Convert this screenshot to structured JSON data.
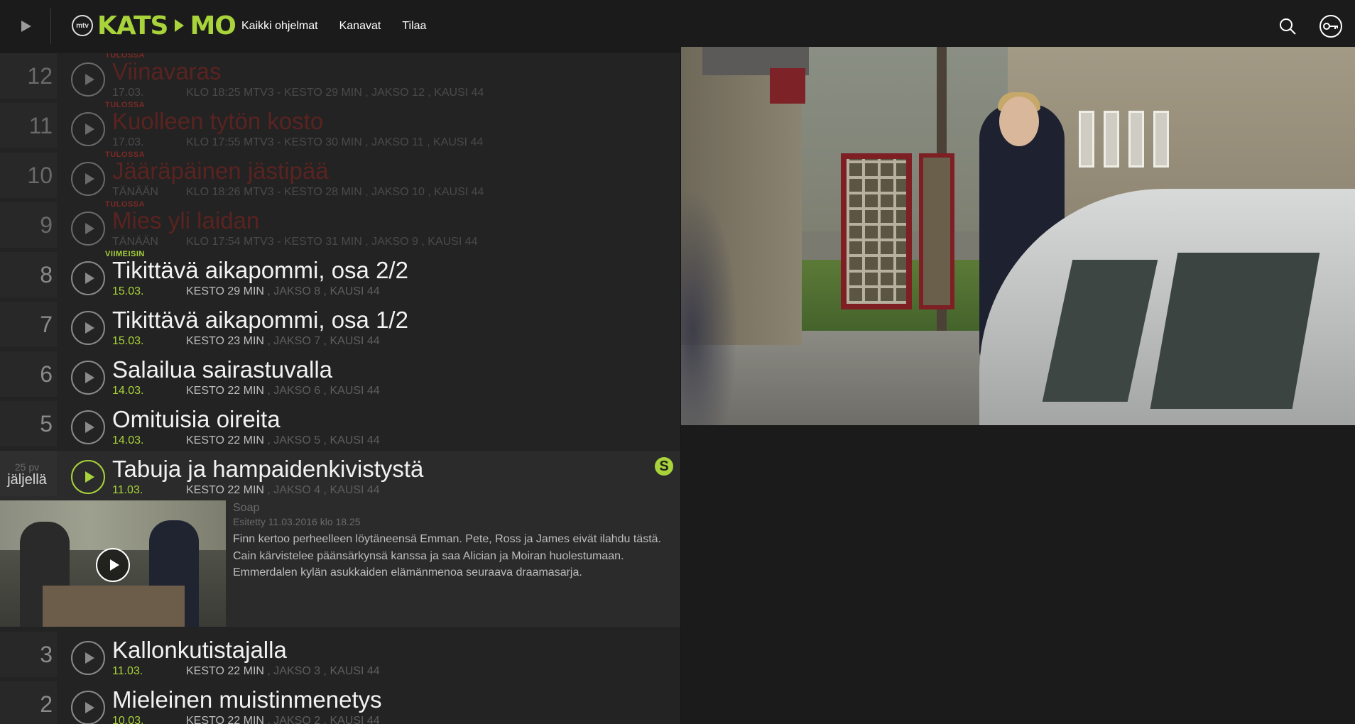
{
  "header": {
    "logo_mtv": "mtv",
    "logo_left": "KATS",
    "logo_right": "MO",
    "nav": [
      "Kaikki ohjelmat",
      "Kanavat",
      "Tilaa"
    ],
    "icons": [
      "play-icon",
      "search-icon",
      "key-icon"
    ]
  },
  "episodes": [
    {
      "num": "12",
      "tag": "TULOSSA",
      "title": "Viinavaras",
      "date": "17.03.",
      "info": "KLO 18:25 MTV3 - KESTO 29 MIN , JAKSO 12 , KAUSI 44",
      "state": "upcoming"
    },
    {
      "num": "11",
      "tag": "TULOSSA",
      "title": "Kuolleen tytön kosto",
      "date": "17.03.",
      "info": "KLO 17:55 MTV3 - KESTO 30 MIN , JAKSO 11 , KAUSI 44",
      "state": "upcoming"
    },
    {
      "num": "10",
      "tag": "TULOSSA",
      "title": "Jääräpäinen jästipää",
      "date": "TÄNÄÄN",
      "info": "KLO 18:26 MTV3 - KESTO 28 MIN , JAKSO 10 , KAUSI 44",
      "state": "upcoming"
    },
    {
      "num": "9",
      "tag": "TULOSSA",
      "title": "Mies yli laidan",
      "date": "TÄNÄÄN",
      "info": "KLO 17:54 MTV3 - KESTO 31 MIN , JAKSO 9 , KAUSI 44",
      "state": "upcoming"
    },
    {
      "num": "8",
      "tag": "VIIMEISIN",
      "title": "Tikittävä aikapommi, osa 2/2",
      "date": "15.03.",
      "duration": "KESTO 29 MIN",
      "rest": " , JAKSO 8 , KAUSI 44",
      "state": "normal"
    },
    {
      "num": "7",
      "tag": "",
      "title": "Tikittävä aikapommi, osa 1/2",
      "date": "15.03.",
      "duration": "KESTO 23 MIN",
      "rest": " , JAKSO 7 , KAUSI 44",
      "state": "normal"
    },
    {
      "num": "6",
      "tag": "",
      "title": "Salailua sairastuvalla",
      "date": "14.03.",
      "duration": "KESTO 22 MIN",
      "rest": " , JAKSO 6 , KAUSI 44",
      "state": "normal"
    },
    {
      "num": "5",
      "tag": "",
      "title": "Omituisia oireita",
      "date": "14.03.",
      "duration": "KESTO 22 MIN",
      "rest": " , JAKSO 5 , KAUSI 44",
      "state": "normal"
    },
    {
      "num": "3",
      "tag": "",
      "title": "Kallonkutistajalla",
      "date": "11.03.",
      "duration": "KESTO 22 MIN",
      "rest": " , JAKSO 3 , KAUSI 44",
      "state": "normal"
    },
    {
      "num": "2",
      "tag": "",
      "title": "Mieleinen muistinmenetys",
      "date": "10.03.",
      "duration": "KESTO 22 MIN",
      "rest": " , JAKSO 2 , KAUSI 44",
      "state": "normal"
    }
  ],
  "selected": {
    "days": "25 pv",
    "remaining": "jäljellä",
    "title": "Tabuja ja hampaidenkivistystä",
    "date": "11.03.",
    "duration": "KESTO 22 MIN",
    "rest": " , JAKSO 4 , KAUSI 44",
    "badge": "S",
    "genre": "Soap",
    "aired": "Esitetty 11.03.2016 klo 18.25",
    "description": "Finn kertoo perheelleen löytäneensä Emman. Pete, Ross ja James eivät ilahdu tästä. Cain kärvistelee päänsärkynsä kanssa ja saa Alician ja Moiran huolestumaan. Emmerdalen kylän asukkaiden elämänmenoa seuraava draamasarja."
  },
  "colors": {
    "accent": "#a8d33a",
    "upcoming": "#7a2a25",
    "bg": "#232323"
  }
}
